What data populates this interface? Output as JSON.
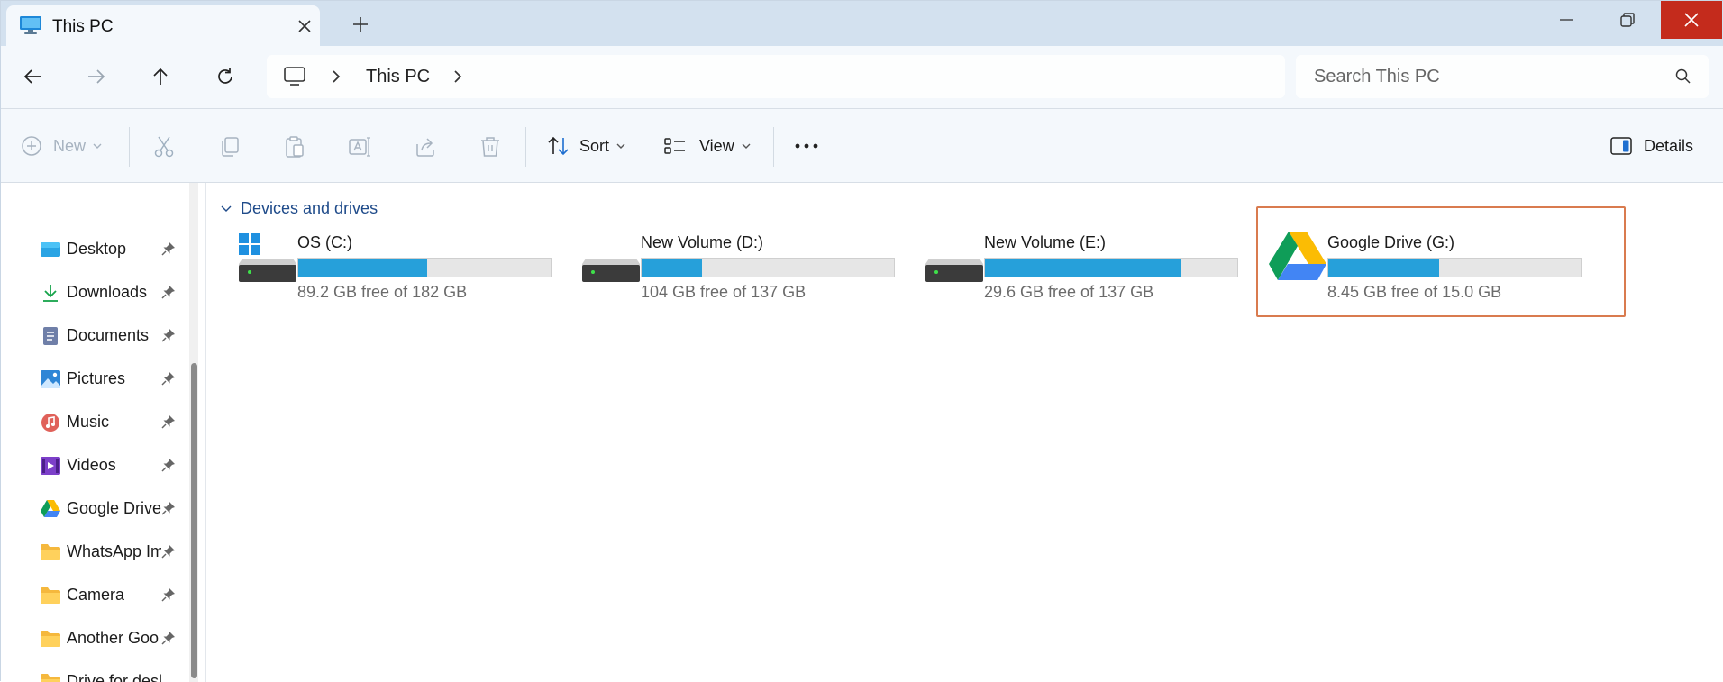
{
  "window": {
    "tab_title": "This PC"
  },
  "nav": {
    "address_segment": "This PC",
    "search_placeholder": "Search This PC"
  },
  "commands": {
    "new_label": "New",
    "sort_label": "Sort",
    "view_label": "View",
    "details_label": "Details"
  },
  "sidebar": {
    "items": [
      {
        "label": "Desktop",
        "icon": "desktop-icon"
      },
      {
        "label": "Downloads",
        "icon": "download-icon"
      },
      {
        "label": "Documents",
        "icon": "documents-icon"
      },
      {
        "label": "Pictures",
        "icon": "pictures-icon"
      },
      {
        "label": "Music",
        "icon": "music-icon"
      },
      {
        "label": "Videos",
        "icon": "videos-icon"
      },
      {
        "label": "Google Drive",
        "icon": "google-drive-icon"
      },
      {
        "label": "WhatsApp Im",
        "icon": "folder-icon"
      },
      {
        "label": "Camera",
        "icon": "folder-icon"
      },
      {
        "label": "Another Goo",
        "icon": "folder-icon"
      },
      {
        "label": "Drive for desktop",
        "icon": "folder-icon"
      }
    ]
  },
  "content": {
    "group_label": "Devices and drives",
    "drives": [
      {
        "name": "OS (C:)",
        "free_text": "89.2 GB free of 182 GB",
        "used_fraction": 0.51,
        "icon": "windows-drive-icon"
      },
      {
        "name": "New Volume (D:)",
        "free_text": "104 GB free of 137 GB",
        "used_fraction": 0.24,
        "icon": "hard-drive-icon"
      },
      {
        "name": "New Volume (E:)",
        "free_text": "29.6 GB free of 137 GB",
        "used_fraction": 0.78,
        "icon": "hard-drive-icon"
      },
      {
        "name": "Google Drive (G:)",
        "free_text": "8.45 GB free of 15.0 GB",
        "used_fraction": 0.44,
        "icon": "google-drive-icon"
      }
    ]
  },
  "colors": {
    "accent": "#26a0da",
    "highlight_border": "#d97b4f",
    "close_button": "#c42b1c"
  }
}
